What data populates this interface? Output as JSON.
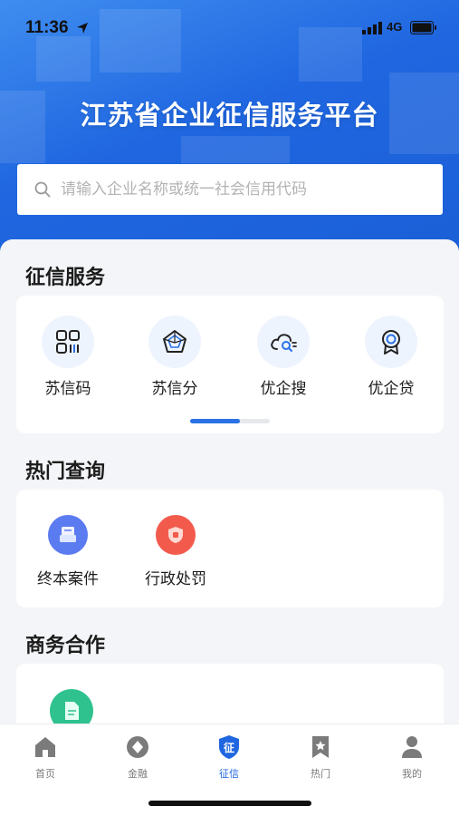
{
  "status_bar": {
    "time": "11:36",
    "network": "4G"
  },
  "header": {
    "title": "江苏省企业征信服务平台",
    "search_placeholder": "请输入企业名称或统一社会信用代码"
  },
  "colors": {
    "brand_blue": "#1f66e0",
    "hero_gradient_start": "#3f8df0",
    "page_bg": "#f4f5f8"
  },
  "credit_services": {
    "title": "征信服务",
    "items": [
      {
        "label": "苏信码",
        "icon": "qr-grid-icon"
      },
      {
        "label": "苏信分",
        "icon": "radar-chart-icon"
      },
      {
        "label": "优企搜",
        "icon": "cloud-search-icon"
      },
      {
        "label": "优企贷",
        "icon": "medal-icon"
      }
    ],
    "carousel_progress": 0.62
  },
  "hot_queries": {
    "title": "热门查询",
    "items": [
      {
        "label": "终本案件",
        "icon": "case-file-icon",
        "color": "#5b7bf0"
      },
      {
        "label": "行政处罚",
        "icon": "penalty-shield-icon",
        "color": "#f25a4c"
      }
    ]
  },
  "business": {
    "title": "商务合作",
    "items": [
      {
        "icon": "document-icon",
        "color": "#2fc28f"
      }
    ]
  },
  "tabbar": {
    "items": [
      {
        "label": "首页",
        "icon": "home-icon"
      },
      {
        "label": "金融",
        "icon": "finance-icon"
      },
      {
        "label": "征信",
        "icon": "credit-shield-icon",
        "badge": "征",
        "active": true
      },
      {
        "label": "热门",
        "icon": "bookmark-star-icon"
      },
      {
        "label": "我的",
        "icon": "user-icon"
      }
    ]
  }
}
